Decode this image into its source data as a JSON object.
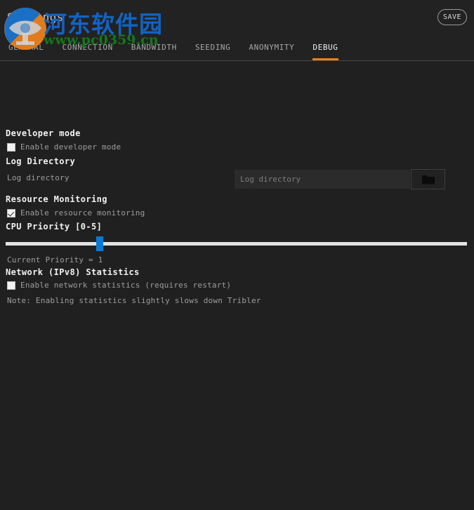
{
  "window": {
    "title": "Settings",
    "save_label": "SAVE"
  },
  "tabs": [
    {
      "label": "GENERAL",
      "active": false
    },
    {
      "label": "CONNECTION",
      "active": false
    },
    {
      "label": "BANDWIDTH",
      "active": false
    },
    {
      "label": "SEEDING",
      "active": false
    },
    {
      "label": "ANONYMITY",
      "active": false
    },
    {
      "label": "DEBUG",
      "active": true
    }
  ],
  "watermark": {
    "chinese_text": "河东软件园",
    "url_text": "www.pc0359.cn"
  },
  "sections": {
    "developer_mode": {
      "title": "Developer mode",
      "checkbox_label": "Enable developer mode",
      "checked": false
    },
    "log_directory": {
      "title": "Log Directory",
      "field_label": "Log directory",
      "input_value": "",
      "input_placeholder": "Log directory",
      "browse_icon": "folder-icon"
    },
    "resource_monitoring": {
      "title": "Resource Monitoring",
      "checkbox_label": "Enable resource monitoring",
      "checked": true
    },
    "cpu_priority": {
      "title": "CPU Priority [0-5]",
      "min": 0,
      "max": 5,
      "value": 1,
      "current_text": "Current Priority = 1",
      "handle_color": "#0a7ad6",
      "track_color": "#e3e3e3"
    },
    "network_statistics": {
      "title": "Network (IPv8) Statistics",
      "checkbox_label": "Enable network statistics (requires restart)",
      "checked": false,
      "note": "Note: Enabling statistics slightly slows down Tribler"
    }
  },
  "colors": {
    "accent": "#ef7f1a",
    "background": "#202020",
    "header_background": "#222222",
    "slider_blue": "#0a7ad6"
  }
}
